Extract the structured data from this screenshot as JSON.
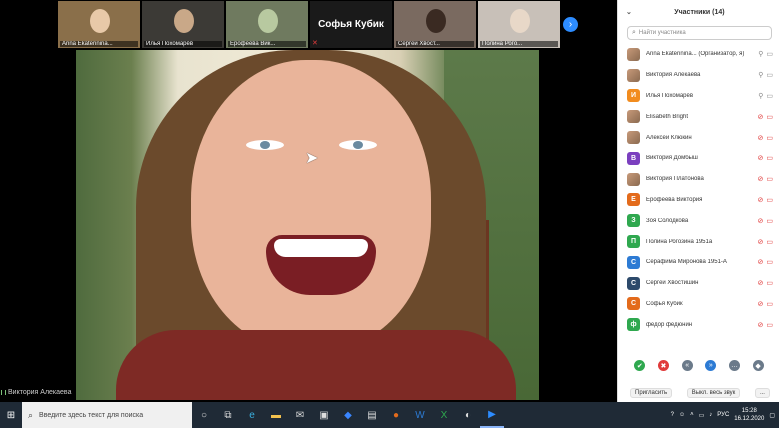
{
  "thumbnails": [
    {
      "caption": "Anna Ekaterinina...",
      "bg": "#8a6f4a",
      "head": "#e8c9a8"
    },
    {
      "caption": "Илья Похомарёв",
      "bg": "#3c3a36",
      "head": "#c9a888"
    },
    {
      "caption": "Ерофеева Вик...",
      "bg": "#6f7a5f",
      "head": "#b8c9a0"
    },
    {
      "caption": "Софья Кубик",
      "nameonly": true
    },
    {
      "caption": "Сергей Хвост...",
      "bg": "#7a6a60",
      "head": "#3a2a22"
    },
    {
      "caption": "Полина Рого...",
      "bg": "#c8c0b8",
      "head": "#e8d8c8"
    }
  ],
  "speaker_label": "Виктория Алекаева",
  "panel": {
    "title": "Участники (14)",
    "search_placeholder": "Найти участника",
    "participants": [
      {
        "name": "Anna Ekaterinina... (Организатор, я)",
        "avatar": "photo",
        "letter": "",
        "color": "#1b8e8e",
        "mic": "on",
        "cam": "on"
      },
      {
        "name": "Виктория Алекаева",
        "avatar": "photo",
        "letter": "",
        "color": "",
        "mic": "on",
        "cam": "on"
      },
      {
        "name": "Илья Похомарёв",
        "avatar": "letter",
        "letter": "И",
        "color": "#f28c1e",
        "mic": "on",
        "cam": "on"
      },
      {
        "name": "Elisabeth Bright",
        "avatar": "photo",
        "letter": "",
        "color": "",
        "mic": "off",
        "cam": "off"
      },
      {
        "name": "Алексей Клюкин",
        "avatar": "photo",
        "letter": "",
        "color": "",
        "mic": "off",
        "cam": "off"
      },
      {
        "name": "Виктория Домбыш",
        "avatar": "letter",
        "letter": "В",
        "color": "#7b3fbf",
        "mic": "off",
        "cam": "off"
      },
      {
        "name": "Виктория Платонова",
        "avatar": "photo",
        "letter": "",
        "color": "",
        "mic": "off",
        "cam": "off"
      },
      {
        "name": "Ерофеева Виктория",
        "avatar": "letter",
        "letter": "Е",
        "color": "#e36b1c",
        "mic": "off",
        "cam": "off"
      },
      {
        "name": "Зоя Солодкова",
        "avatar": "letter",
        "letter": "З",
        "color": "#2fa84f",
        "mic": "off",
        "cam": "off"
      },
      {
        "name": "Полина Рогозина 1951а",
        "avatar": "letter",
        "letter": "П",
        "color": "#2fa84f",
        "mic": "off",
        "cam": "off"
      },
      {
        "name": "Серафима Миронова 1951-А",
        "avatar": "letter",
        "letter": "С",
        "color": "#2d7bd4",
        "mic": "off",
        "cam": "off"
      },
      {
        "name": "Сергей Хвостишин",
        "avatar": "letter",
        "letter": "С",
        "color": "#2d4a6b",
        "mic": "off",
        "cam": "off"
      },
      {
        "name": "Софья Кубик",
        "avatar": "letter",
        "letter": "С",
        "color": "#e36b1c",
        "mic": "off",
        "cam": "off"
      },
      {
        "name": "федор федюнин",
        "avatar": "letter",
        "letter": "ф",
        "color": "#2fa84f",
        "mic": "off",
        "cam": "off"
      }
    ],
    "reactions": [
      {
        "glyph": "✔",
        "color": "#2fa84f",
        "name": "yes-icon"
      },
      {
        "glyph": "✖",
        "color": "#e03a3a",
        "name": "no-icon"
      },
      {
        "glyph": "«",
        "color": "#6b7a8a",
        "name": "go-slower-icon"
      },
      {
        "glyph": "»",
        "color": "#2d7bd4",
        "name": "go-faster-icon"
      },
      {
        "glyph": "…",
        "color": "#6b7a8a",
        "name": "more-reactions-icon"
      },
      {
        "glyph": "◆",
        "color": "#6b7a8a",
        "name": "clear-icon"
      }
    ],
    "invite_label": "Пригласить",
    "mute_all_label": "Выкл. весь звук",
    "more_label": "..."
  },
  "taskbar": {
    "search_placeholder": "Введите здесь текст для поиска",
    "lang": "РУС",
    "time": "15:28",
    "date": "16.12.2020"
  }
}
